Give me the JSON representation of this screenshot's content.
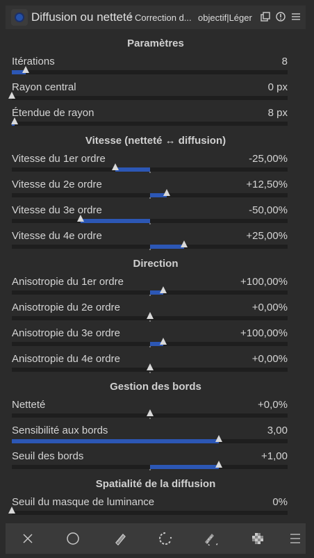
{
  "header": {
    "title": "Diffusion ou netteté",
    "separator": "•",
    "subtitle": "Correction d...",
    "instance": "objectif|Léger"
  },
  "sections": [
    {
      "id": "params",
      "title": "Paramètres"
    },
    {
      "id": "speed",
      "title": "Vitesse (netteté ↔ diffusion)"
    },
    {
      "id": "direction",
      "title": "Direction"
    },
    {
      "id": "edges",
      "title": "Gestion des bords"
    },
    {
      "id": "spatial",
      "title": "Spatialité de la diffusion"
    }
  ],
  "sliders": [
    {
      "label": "Itérations",
      "value": "8",
      "fraction": 0.05,
      "origin": 0.0
    },
    {
      "label": "Rayon central",
      "value": "0 px",
      "fraction": 0.0,
      "origin": 0.0
    },
    {
      "label": "Étendue de rayon",
      "value": "8 px",
      "fraction": 0.01,
      "origin": 0.0
    },
    {
      "label": "Vitesse du 1er ordre",
      "value": "-25,00%",
      "fraction": 0.375,
      "origin": 0.5
    },
    {
      "label": "Vitesse du 2e ordre",
      "value": "+12,50%",
      "fraction": 0.5625,
      "origin": 0.5
    },
    {
      "label": "Vitesse du 3e ordre",
      "value": "-50,00%",
      "fraction": 0.25,
      "origin": 0.5
    },
    {
      "label": "Vitesse du 4e ordre",
      "value": "+25,00%",
      "fraction": 0.625,
      "origin": 0.5
    },
    {
      "label": "Anisotropie du 1er ordre",
      "value": "+100,00%",
      "fraction": 0.55,
      "origin": 0.5
    },
    {
      "label": "Anisotropie du 2e ordre",
      "value": "+0,00%",
      "fraction": 0.5,
      "origin": 0.5
    },
    {
      "label": "Anisotropie du 3e ordre",
      "value": "+100,00%",
      "fraction": 0.55,
      "origin": 0.5
    },
    {
      "label": "Anisotropie du 4e ordre",
      "value": "+0,00%",
      "fraction": 0.5,
      "origin": 0.5
    },
    {
      "label": "Netteté",
      "value": "+0,0%",
      "fraction": 0.5,
      "origin": 0.5
    },
    {
      "label": "Sensibilité aux bords",
      "value": "3,00",
      "fraction": 0.75,
      "origin": 0.0
    },
    {
      "label": "Seuil des bords",
      "value": "+1,00",
      "fraction": 0.75,
      "origin": 0.5
    },
    {
      "label": "Seuil du masque de luminance",
      "value": "0%",
      "fraction": 0.0,
      "origin": 0.0
    }
  ],
  "bottom_buttons": [
    {
      "icon": "close-icon"
    },
    {
      "icon": "circle-icon"
    },
    {
      "icon": "pencil-icon"
    },
    {
      "icon": "drawn-parametric-icon"
    },
    {
      "icon": "parametric-pencil-icon"
    },
    {
      "icon": "raster-mask-icon"
    },
    {
      "icon": "menu-icon"
    }
  ],
  "colors": {
    "accent": "#2c57b5",
    "background": "#2b2b2b",
    "header": "#333333",
    "track": "#1e1e1e"
  }
}
